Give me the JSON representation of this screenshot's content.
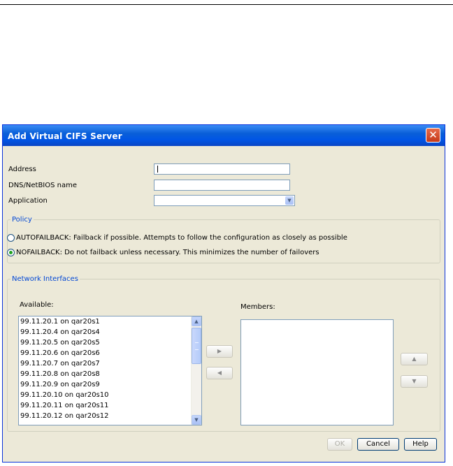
{
  "dialog": {
    "title": "Add Virtual CIFS Server",
    "close_icon": "✕"
  },
  "form": {
    "address_label": "Address",
    "address_value": "",
    "dns_label": "DNS/NetBIOS name",
    "dns_value": "",
    "application_label": "Application",
    "application_selected": ""
  },
  "policy": {
    "legend": "Policy",
    "options": [
      {
        "label": "AUTOFAILBACK: Failback if possible. Attempts to follow the configuration as closely as possible",
        "selected": false
      },
      {
        "label": "NOFAILBACK: Do not failback unless necessary. This minimizes the number of failovers",
        "selected": true
      }
    ]
  },
  "network": {
    "legend": "Network Interfaces",
    "available_label": "Available:",
    "members_label": "Members:",
    "available": [
      "99.11.20.1 on qar20s1",
      "99.11.20.4 on qar20s4",
      "99.11.20.5 on qar20s5",
      "99.11.20.6 on qar20s6",
      "99.11.20.7 on qar20s7",
      "99.11.20.8 on qar20s8",
      "99.11.20.9 on qar20s9",
      "99.11.20.10 on qar20s10",
      "99.11.20.11 on qar20s11",
      "99.11.20.12 on qar20s12"
    ],
    "members": [],
    "add_icon": "▶",
    "remove_icon": "◀",
    "move_up_icon": "▲",
    "move_down_icon": "▼"
  },
  "buttons": {
    "ok": "OK",
    "cancel": "Cancel",
    "help": "Help"
  }
}
